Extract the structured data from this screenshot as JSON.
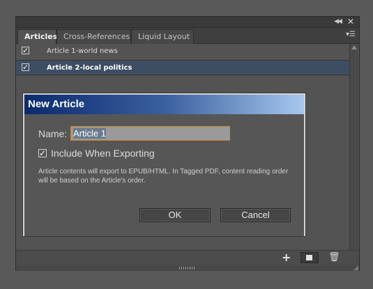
{
  "panel": {
    "tabs": [
      {
        "label": "Articles",
        "active": true
      },
      {
        "label": "Cross-References",
        "active": false
      },
      {
        "label": "Liquid Layout",
        "active": false
      }
    ],
    "articles": [
      {
        "label": "Article 1-world news",
        "checked": true,
        "selected": false
      },
      {
        "label": "Article 2-local politics",
        "checked": true,
        "selected": true
      }
    ],
    "toolbar_icons": [
      "add-icon",
      "new-article-icon",
      "delete-icon"
    ],
    "top_icons": [
      "collapse-icon",
      "close-icon"
    ]
  },
  "dialog": {
    "title": "New Article",
    "name_label": "Name:",
    "name_value": "Article 1",
    "include_label": "Include When Exporting",
    "include_checked": true,
    "info": "Article contents will export to EPUB/HTML. In Tagged PDF, content reading order will be based on the Article's order.",
    "ok_label": "OK",
    "cancel_label": "Cancel"
  },
  "glyphs": {
    "check": "✓",
    "collapse": "◀◀",
    "close": "✕",
    "menu": "▾☰",
    "add": "+",
    "trash": "🗑"
  },
  "colors": {
    "selected_row": "#3e4e62",
    "title_gradient_start": "#0a2a6e",
    "title_gradient_end": "#a6c7ee",
    "input_focus_border": "#c88a2a"
  }
}
